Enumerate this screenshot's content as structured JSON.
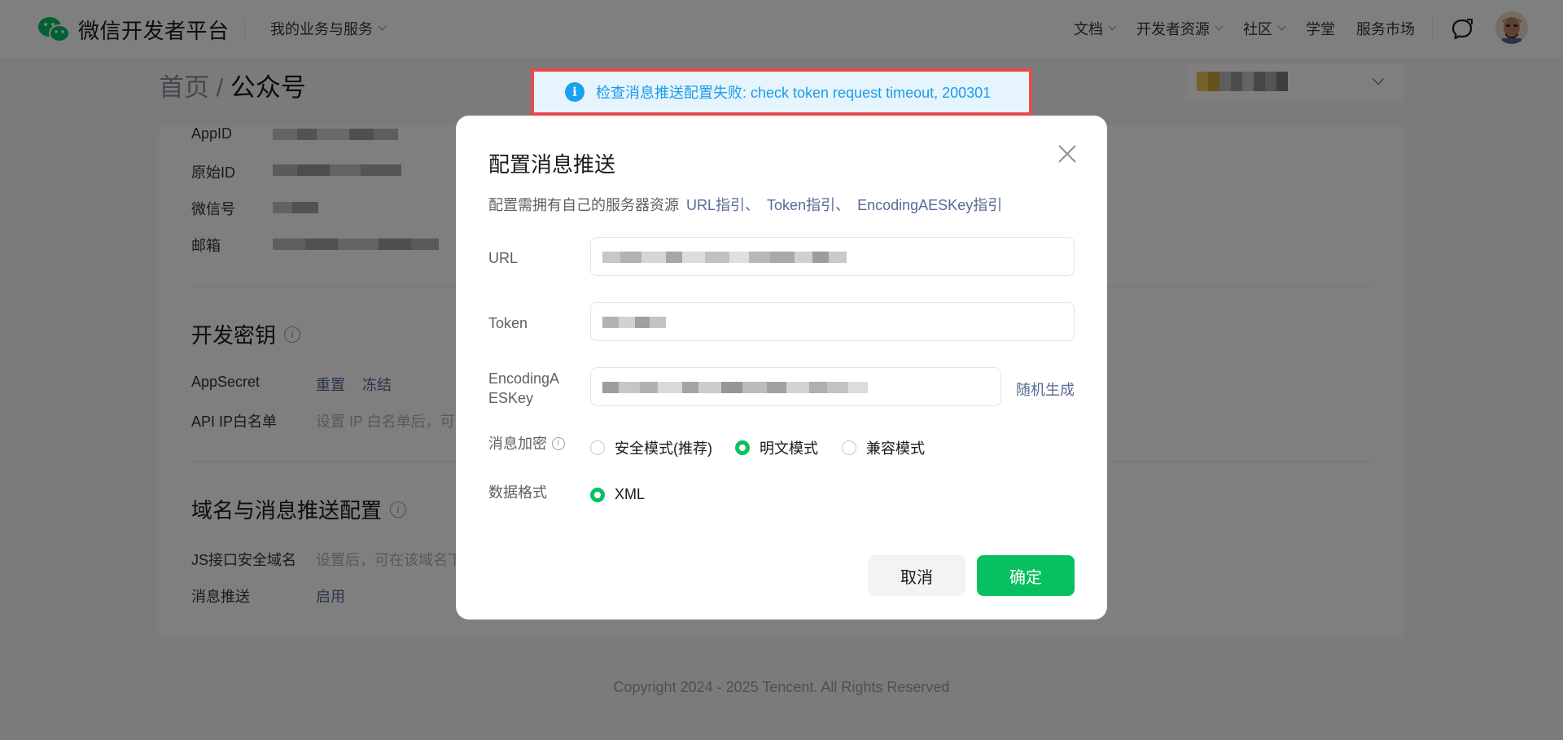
{
  "header": {
    "brand": "微信开发者平台",
    "biz_menu": "我的业务与服务",
    "nav": [
      "文档",
      "开发者资源",
      "社区",
      "学堂",
      "服务市场"
    ],
    "icons": [
      "wechat-logo-icon",
      "chat-bubble-icon",
      "user-avatar"
    ]
  },
  "breadcrumb": {
    "home": "首页",
    "sep": "/",
    "current": "公众号"
  },
  "account_info": {
    "labels": [
      "AppID",
      "原始ID",
      "微信号",
      "邮箱"
    ]
  },
  "dev_key": {
    "title": "开发密钥",
    "appsecret_label": "AppSecret",
    "reset": "重置",
    "freeze": "冻结",
    "ip_label": "API IP白名单",
    "ip_hint": "设置 IP 白名单后，可调"
  },
  "domain_push": {
    "title": "域名与消息推送配置",
    "js_label": "JS接口安全域名",
    "js_hint": "设置后，可在该域名下",
    "push_label": "消息推送",
    "push_enable": "启用"
  },
  "footer": "Copyright 2024 - 2025 Tencent. All Rights Reserved",
  "toast": {
    "message": "检查消息推送配置失败: check token request timeout, 200301",
    "color": "#1a9ce8"
  },
  "dialog": {
    "title": "配置消息推送",
    "desc": "配置需拥有自己的服务器资源",
    "guides": [
      "URL指引、",
      "Token指引、",
      "EncodingAESKey指引"
    ],
    "fields": {
      "url_label": "URL",
      "token_label": "Token",
      "aes_label_1": "EncodingA",
      "aes_label_2": "ESKey",
      "random_generate": "随机生成"
    },
    "encryption": {
      "label": "消息加密",
      "options": [
        "安全模式(推荐)",
        "明文模式",
        "兼容模式"
      ],
      "selected": "明文模式"
    },
    "format": {
      "label": "数据格式",
      "options": [
        "XML"
      ],
      "selected": "XML"
    },
    "cancel": "取消",
    "confirm": "确定",
    "accent": "#07c160"
  }
}
